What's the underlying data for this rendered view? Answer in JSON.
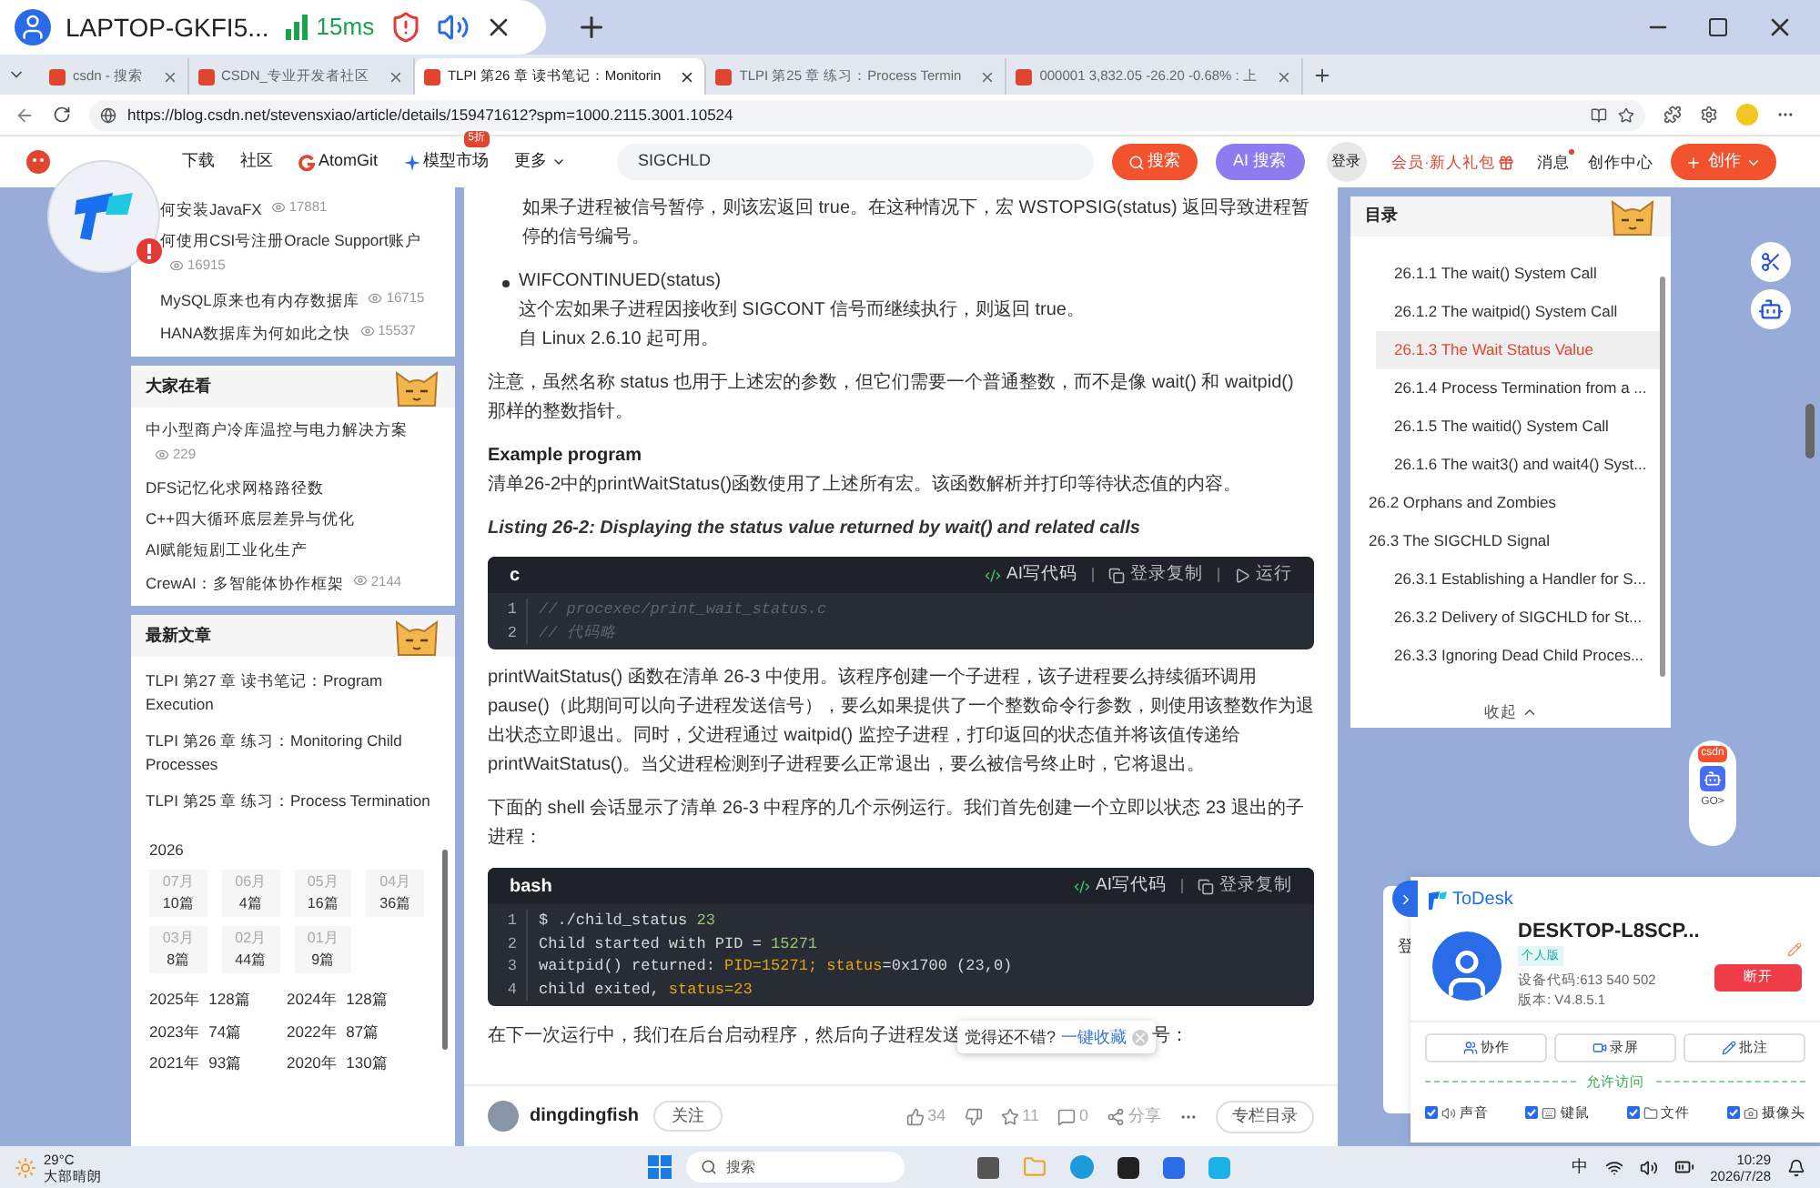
{
  "remote_bar": {
    "device": "LAPTOP-GKFI5...",
    "latency": "15ms"
  },
  "tabs": [
    {
      "title": "csdn - 搜索",
      "selected": false
    },
    {
      "title": "CSDN_专业开发者社区",
      "selected": false
    },
    {
      "title": "TLPI 第26 章 读书笔记：Monitorin",
      "selected": true
    },
    {
      "title": "TLPI 第25 章 练习：Process Termin",
      "selected": false
    },
    {
      "title": "000001 3,832.05 -26.20 -0.68% : 上",
      "selected": false
    }
  ],
  "address_bar": {
    "url": "https://blog.csdn.net/stevensxiao/article/details/159471612?spm=1000.2115.3001.10524"
  },
  "site_header": {
    "nav": [
      {
        "label": "下载",
        "kind": "text"
      },
      {
        "label": "社区",
        "kind": "text"
      },
      {
        "label": "AtomGit",
        "kind": "atomgit"
      },
      {
        "label": "模型市场",
        "kind": "model",
        "badge": "5折"
      },
      {
        "label": "更多",
        "kind": "more"
      }
    ],
    "search": {
      "value": "SIGCHLD"
    },
    "search_button": "搜索",
    "ai_search_button": "AI 搜索",
    "login": "登录",
    "member": "会员·新人礼包",
    "messages": "消息",
    "creator_center": "创作中心",
    "create_button": "创作"
  },
  "hot_articles": [
    {
      "title": "何安装JavaFX",
      "views": "17881"
    },
    {
      "title": "何使用CSI号注册Oracle Support账户",
      "views": "16915"
    },
    {
      "title": "MySQL原来也有内存数据库",
      "views": "16715"
    },
    {
      "title": "HANA数据库为何如此之快",
      "views": "15537"
    }
  ],
  "trending": {
    "title": "大家在看",
    "items": [
      {
        "title": "中小型商户冷库温控与电力解决方案",
        "views": "229"
      },
      {
        "title": "DFS记忆化求网格路径数"
      },
      {
        "title": "C++四大循环底层差异与优化"
      },
      {
        "title": "AI赋能短剧工业化生产"
      },
      {
        "title": "CrewAI：多智能体协作框架",
        "views": "2144"
      }
    ]
  },
  "latest": {
    "title": "最新文章",
    "items": [
      "TLPI 第27 章 读书笔记：Program Execution",
      "TLPI 第26 章 练习：Monitoring Child Processes",
      "TLPI 第25 章 练习：Process Termination"
    ],
    "archive": {
      "year": "2026",
      "months": [
        {
          "month": "07月",
          "count": "10篇"
        },
        {
          "month": "06月",
          "count": "4篇"
        },
        {
          "month": "05月",
          "count": "16篇"
        },
        {
          "month": "04月",
          "count": "36篇"
        },
        {
          "month": "03月",
          "count": "8篇"
        },
        {
          "month": "02月",
          "count": "44篇"
        },
        {
          "month": "01月",
          "count": "9篇"
        }
      ],
      "years": [
        {
          "year": "2025年",
          "count": "128篇"
        },
        {
          "year": "2024年",
          "count": "128篇"
        },
        {
          "year": "2023年",
          "count": "74篇"
        },
        {
          "year": "2022年",
          "count": "87篇"
        },
        {
          "year": "2021年",
          "count": "93篇"
        },
        {
          "year": "2020年",
          "count": "130篇"
        }
      ]
    }
  },
  "article": {
    "blocks": [
      {
        "kind": "continuation",
        "text": "如果子进程被信号暂停，则该宏返回 true。在这种情况下，宏 WSTOPSIG(status) 返回导致进程暂停的信号编号。"
      },
      {
        "kind": "bullet",
        "title": "WIFCONTINUED(status)",
        "lines": [
          "这个宏如果子进程因接收到 SIGCONT 信号而继续执行，则返回 true。",
          "自 Linux 2.6.10 起可用。"
        ]
      },
      {
        "kind": "paragraph",
        "text": "注意，虽然名称 status 也用于上述宏的参数，但它们需要一个普通整数，而不是像 wait() 和 waitpid() 那样的整数指针。"
      },
      {
        "kind": "heading",
        "title": "Example program",
        "text": "清单26-2中的printWaitStatus()函数使用了上述所有宏。该函数解析并打印等待状态值的内容。"
      },
      {
        "kind": "caption",
        "text": "Listing 26-2: Displaying the status value returned by wait() and related calls"
      },
      {
        "kind": "code",
        "language": "c",
        "actions": [
          {
            "kind": "ai",
            "label": "AI写代码"
          },
          {
            "kind": "copy",
            "label": "登录复制"
          },
          {
            "kind": "run",
            "label": "运行"
          }
        ],
        "lines": [
          {
            "number": "1",
            "tokens": [
              {
                "text": "// procexec/print_wait_status.c",
                "kind": "comment"
              }
            ]
          },
          {
            "number": "2",
            "tokens": [
              {
                "text": "// 代码略",
                "kind": "comment"
              }
            ]
          }
        ]
      },
      {
        "kind": "paragraph",
        "text": "printWaitStatus() 函数在清单 26-3 中使用。该程序创建一个子进程，该子进程要么持续循环调用 pause()（此期间可以向子进程发送信号），要么如果提供了一个整数命令行参数，则使用该整数作为退出状态立即退出。同时，父进程通过 waitpid() 监控子进程，打印返回的状态值并将该值传递给 printWaitStatus()。当父进程检测到子进程要么正常退出，要么被信号终止时，它将退出。"
      },
      {
        "kind": "paragraph",
        "text": "下面的 shell 会话显示了清单 26-3 中程序的几个示例运行。我们首先创建一个立即以状态 23 退出的子进程："
      },
      {
        "kind": "code",
        "language": "bash",
        "actions": [
          {
            "kind": "ai",
            "label": "AI写代码"
          },
          {
            "kind": "copy",
            "label": "登录复制"
          }
        ],
        "lines": [
          {
            "number": "1",
            "tokens": [
              {
                "text": "$ ./child_status ",
                "kind": "plain"
              },
              {
                "text": "23",
                "kind": "number"
              }
            ]
          },
          {
            "number": "2",
            "tokens": [
              {
                "text": "Child started with PID = ",
                "kind": "plain"
              },
              {
                "text": "15271",
                "kind": "number"
              }
            ]
          },
          {
            "number": "3",
            "tokens": [
              {
                "text": "waitpid() returned: ",
                "kind": "plain"
              },
              {
                "text": "PID=15271; status",
                "kind": "key"
              },
              {
                "text": "=0x1700 (23,0)",
                "kind": "plain"
              }
            ]
          },
          {
            "number": "4",
            "tokens": [
              {
                "text": "child exited, ",
                "kind": "plain"
              },
              {
                "text": "status=23",
                "kind": "key"
              }
            ]
          }
        ]
      },
      {
        "kind": "tooltip_paragraph",
        "before": "在下一次运行中，我们在后台启动程序，然后向子进程发送",
        "after": "号：",
        "tooltip": "觉得还不错?",
        "link": "一键收藏"
      }
    ],
    "author_bar": {
      "name": "dingdingfish",
      "follow": "关注",
      "likes": "34",
      "favorites": "11",
      "comments": "0",
      "share": "分享",
      "column_toc": "专栏目录"
    }
  },
  "toc": {
    "title": "目录",
    "items": [
      {
        "children": [
          {
            "label": "26.1.1 The wait() System Call",
            "selected": false
          },
          {
            "label": "26.1.2 The waitpid() System Call",
            "selected": false
          },
          {
            "label": "26.1.3 The Wait Status Value",
            "selected": true
          },
          {
            "label": "26.1.4 Process Termination from a ...",
            "selected": false
          },
          {
            "label": "26.1.5 The waitid() System Call",
            "selected": false
          },
          {
            "label": "26.1.6 The wait3() and wait4() Syst...",
            "selected": false
          }
        ]
      },
      {
        "label": "26.2 Orphans and Zombies",
        "selected": false
      },
      {
        "label": "26.3 The SIGCHLD Signal",
        "selected": false,
        "children": [
          {
            "label": "26.3.1 Establishing a Handler for S...",
            "selected": false
          },
          {
            "label": "26.3.2 Delivery of SIGCHLD for St...",
            "selected": false
          },
          {
            "label": "26.3.3 Ignoring Dead Child Proces...",
            "selected": false
          }
        ]
      }
    ],
    "collapse": "收起"
  },
  "side_widget": {
    "label": "csdn",
    "go": "GO>"
  },
  "todesk": {
    "brand": "ToDesk",
    "behind_text": "登",
    "device": "DESKTOP-L8SCP...",
    "edition": "个人版",
    "device_code": "设备代码:613 540 502",
    "version": "版本: V4.8.5.1",
    "disconnect": "断开",
    "actions": [
      {
        "kind": "collab",
        "label": "协作"
      },
      {
        "kind": "record",
        "label": "录屏"
      },
      {
        "kind": "annotate",
        "label": "批注"
      }
    ],
    "access_title": "允许访问",
    "permissions": [
      {
        "kind": "sound",
        "label": "声音",
        "checked": true
      },
      {
        "kind": "keyboard",
        "label": "键鼠",
        "checked": true
      },
      {
        "kind": "file",
        "label": "文件",
        "checked": true
      },
      {
        "kind": "camera",
        "label": "摄像头",
        "checked": true
      }
    ]
  },
  "taskbar": {
    "temperature": "29°C",
    "weather": "大部晴朗",
    "search": "搜索",
    "ime": "中",
    "time": "10:29",
    "date": "2026/7/28"
  }
}
